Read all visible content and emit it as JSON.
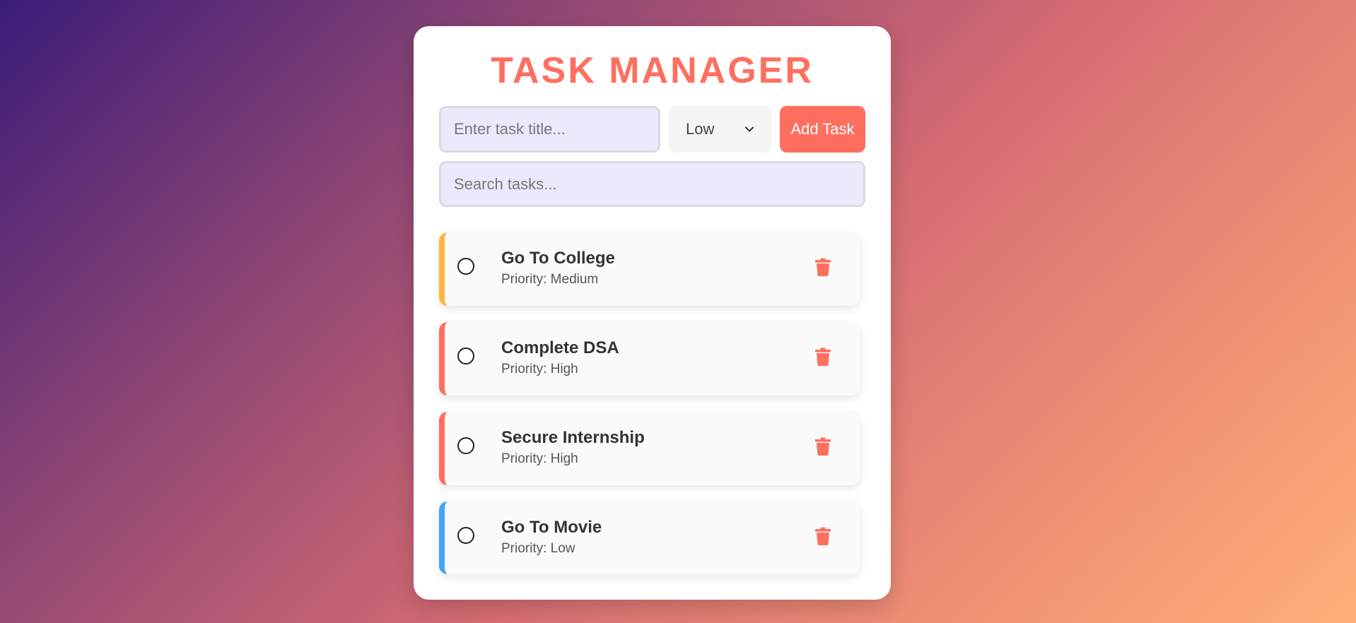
{
  "header": {
    "title": "TASK MANAGER"
  },
  "new_task": {
    "title_placeholder": "Enter task title...",
    "priority_selected": "Low",
    "priority_options": [
      "Low"
    ],
    "add_label": "Add Task"
  },
  "search": {
    "placeholder": "Search tasks..."
  },
  "colors": {
    "accent": "#ff6f5f",
    "priority_medium": "#ffb545",
    "priority_high": "#ff6f5f",
    "priority_low": "#42a5f5"
  },
  "tasks": [
    {
      "title": "Go To College",
      "priority": "Priority: Medium",
      "level": "medium",
      "done": false,
      "icons": [
        "circle-checkbox-icon",
        "trash-icon"
      ]
    },
    {
      "title": "Complete DSA",
      "priority": "Priority: High",
      "level": "high",
      "done": false,
      "icons": [
        "circle-checkbox-icon",
        "trash-icon"
      ]
    },
    {
      "title": "Secure Internship",
      "priority": "Priority: High",
      "level": "high",
      "done": false,
      "icons": [
        "circle-checkbox-icon",
        "trash-icon"
      ]
    },
    {
      "title": "Go To Movie",
      "priority": "Priority: Low",
      "level": "low",
      "done": false,
      "icons": [
        "circle-checkbox-icon",
        "trash-icon"
      ]
    }
  ]
}
